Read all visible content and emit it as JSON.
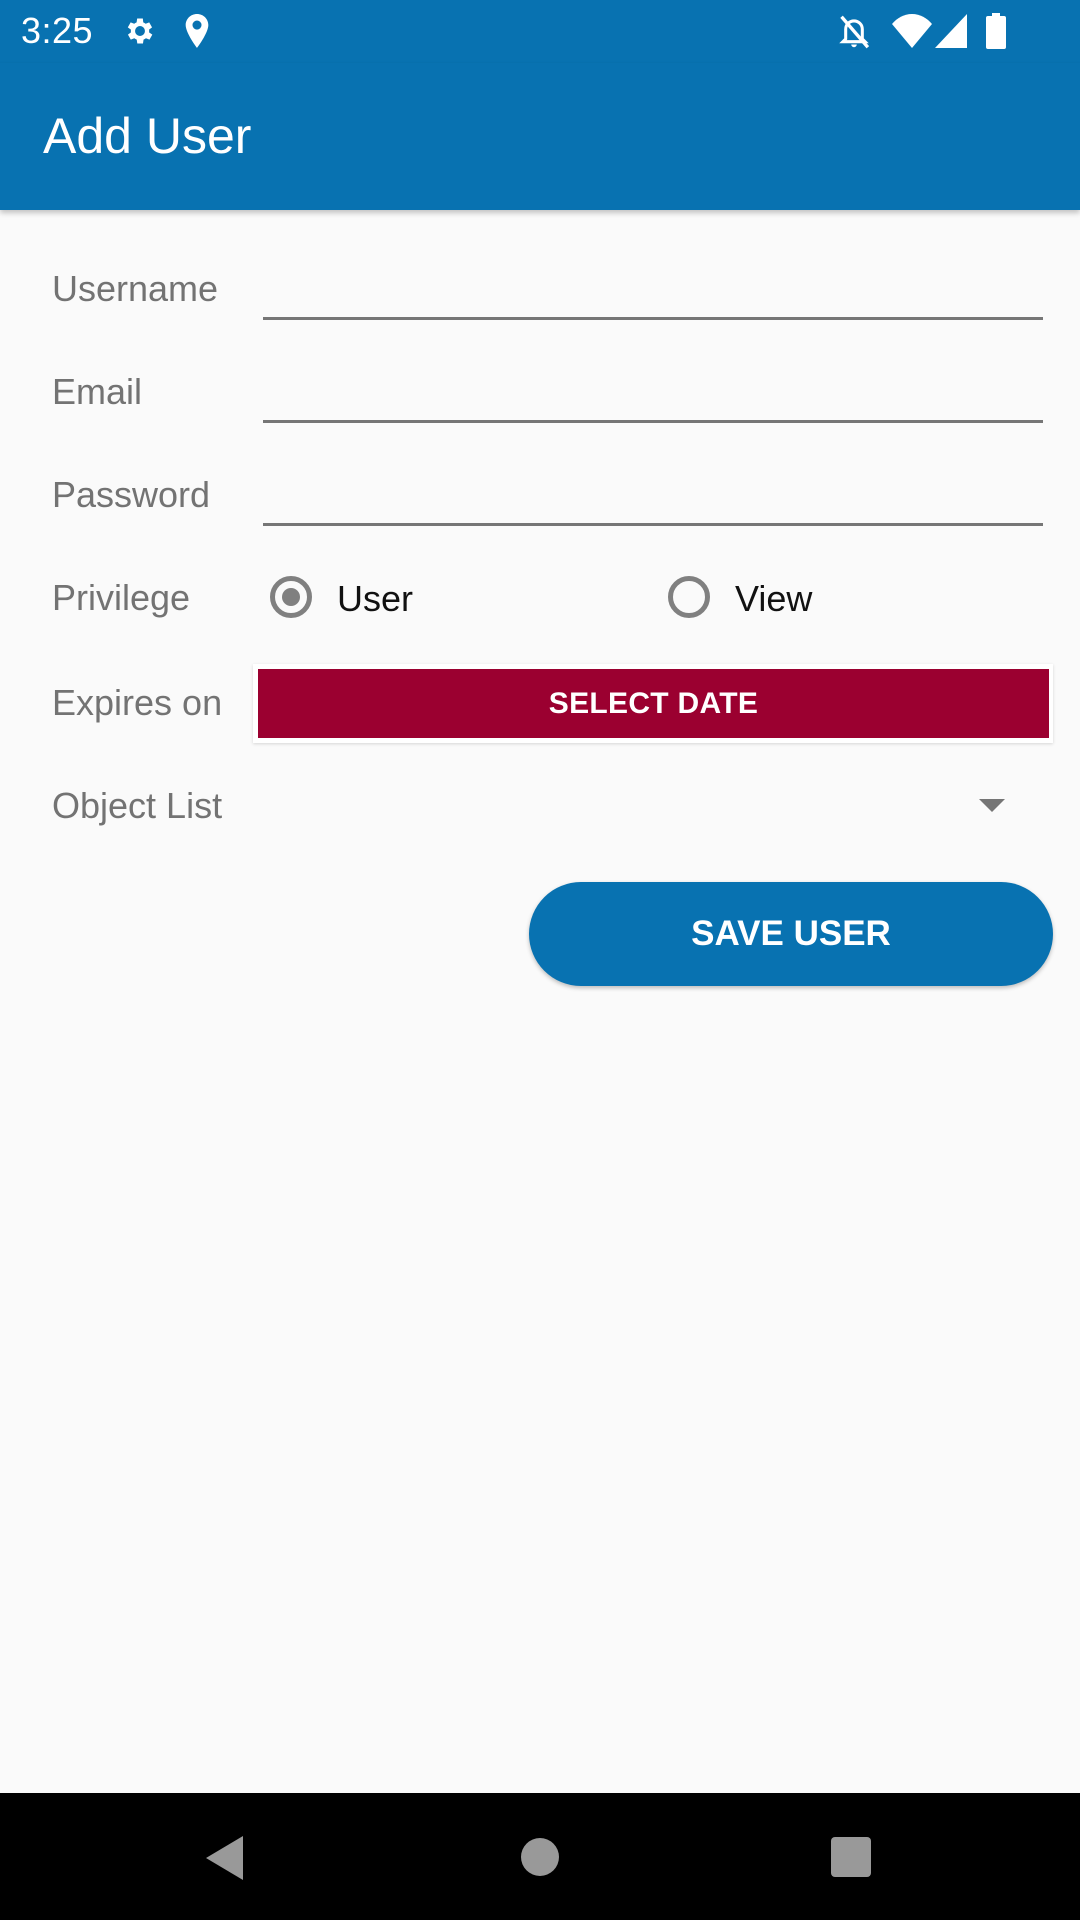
{
  "status_bar": {
    "time": "3:25",
    "left_icons": [
      "gear-icon",
      "location-pin-icon"
    ],
    "right_icons": [
      "notifications-off-icon",
      "wifi-icon",
      "cell-signal-icon",
      "battery-icon"
    ]
  },
  "app_bar": {
    "title": "Add User",
    "color": "#0872b1"
  },
  "form": {
    "username": {
      "label": "Username",
      "value": ""
    },
    "email": {
      "label": "Email",
      "value": ""
    },
    "password": {
      "label": "Password",
      "value": ""
    },
    "privilege": {
      "label": "Privilege",
      "options": [
        {
          "label": "User",
          "selected": true
        },
        {
          "label": "View",
          "selected": false
        }
      ]
    },
    "expires_on": {
      "label": "Expires on",
      "button_label": "SELECT DATE",
      "button_color": "#9b0030"
    },
    "object_list": {
      "label": "Object List",
      "selected_value": ""
    },
    "save_button_label": "SAVE USER"
  },
  "nav_bar": {
    "buttons": [
      "back",
      "home",
      "recents"
    ]
  }
}
